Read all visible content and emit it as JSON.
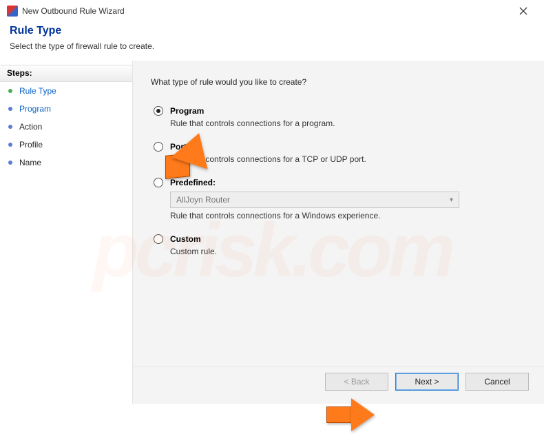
{
  "window": {
    "title": "New Outbound Rule Wizard"
  },
  "header": {
    "heading": "Rule Type",
    "subtitle": "Select the type of firewall rule to create."
  },
  "sidebar": {
    "steps_label": "Steps:",
    "items": [
      {
        "label": "Rule Type",
        "bullet": "green",
        "state": "current"
      },
      {
        "label": "Program",
        "bullet": "blue",
        "state": "link"
      },
      {
        "label": "Action",
        "bullet": "blue",
        "state": "normal"
      },
      {
        "label": "Profile",
        "bullet": "blue",
        "state": "normal"
      },
      {
        "label": "Name",
        "bullet": "blue",
        "state": "normal"
      }
    ]
  },
  "main": {
    "prompt": "What type of rule would you like to create?",
    "options": {
      "program": {
        "label": "Program",
        "desc": "Rule that controls connections for a program.",
        "selected": true
      },
      "port": {
        "label": "Port",
        "desc": "Rule that controls connections for a TCP or UDP port.",
        "selected": false
      },
      "predefined": {
        "label": "Predefined:",
        "combo_value": "AllJoyn Router",
        "desc": "Rule that controls connections for a Windows experience.",
        "selected": false
      },
      "custom": {
        "label": "Custom",
        "desc": "Custom rule.",
        "selected": false
      }
    }
  },
  "footer": {
    "back": "< Back",
    "next": "Next >",
    "cancel": "Cancel"
  },
  "watermark": "pcrisk.com"
}
